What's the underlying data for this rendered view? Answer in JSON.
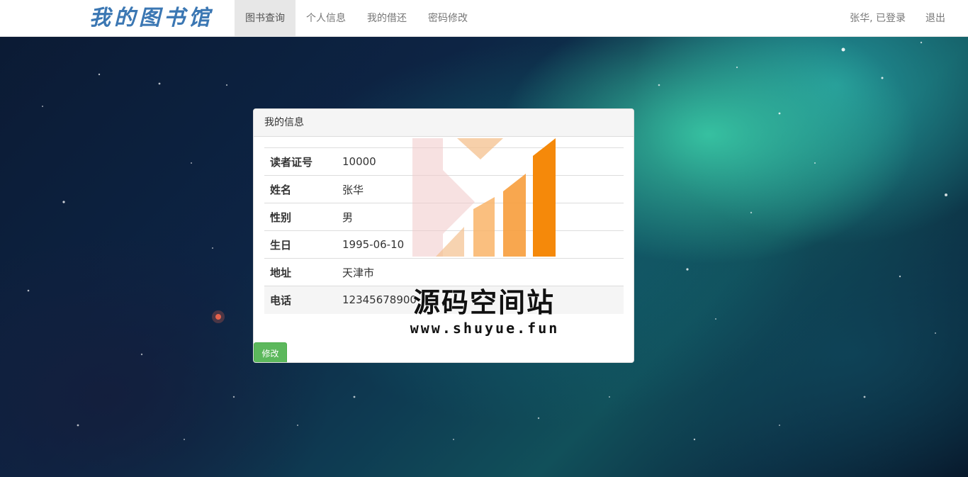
{
  "navbar": {
    "brand": "我的图书馆",
    "items": [
      {
        "label": "图书查询",
        "active": true
      },
      {
        "label": "个人信息",
        "active": false
      },
      {
        "label": "我的借还",
        "active": false
      },
      {
        "label": "密码修改",
        "active": false
      }
    ],
    "user_status": "张华, 已登录",
    "logout_label": "退出"
  },
  "panel": {
    "title": "我的信息",
    "rows": [
      {
        "label": "读者证号",
        "value": "10000"
      },
      {
        "label": "姓名",
        "value": "张华"
      },
      {
        "label": "性别",
        "value": "男"
      },
      {
        "label": "生日",
        "value": "1995-06-10"
      },
      {
        "label": "地址",
        "value": "天津市"
      },
      {
        "label": "电话",
        "value": "12345678900"
      }
    ],
    "edit_button": "修改"
  },
  "watermark": {
    "title": "源码空间站",
    "url": "www.shuyue.fun"
  },
  "colors": {
    "brand": "#3b77b3",
    "button_success": "#5cb85c",
    "watermark_orange": "#f5890a"
  }
}
